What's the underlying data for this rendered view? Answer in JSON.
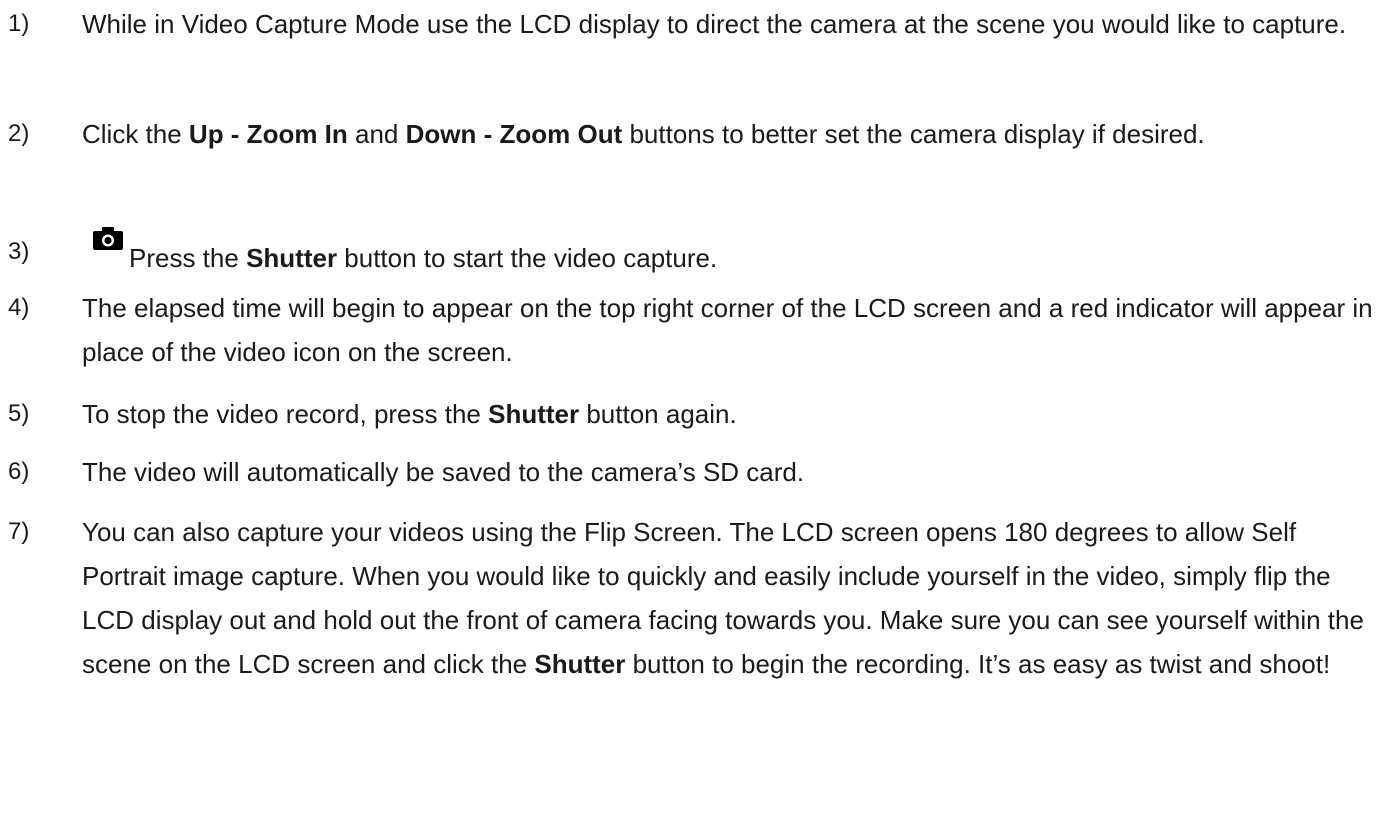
{
  "steps": [
    {
      "number": "1)",
      "parts": [
        {
          "text": "While in Video Capture Mode use the LCD display to direct the camera at the scene you would like to capture."
        }
      ]
    },
    {
      "number": "2)",
      "parts": [
        {
          "text": "Click the "
        },
        {
          "text": "Up - Zoom In",
          "bold": true
        },
        {
          "text": " and "
        },
        {
          "text": "Down - Zoom Out",
          "bold": true
        },
        {
          "text": " buttons to better set the camera display if desired."
        }
      ]
    },
    {
      "number": "3)",
      "icon": "camera-icon",
      "parts": [
        {
          "text": "Press the "
        },
        {
          "text": "Shutter",
          "bold": true
        },
        {
          "text": " button to start the video capture."
        }
      ]
    },
    {
      "number": "4)",
      "parts": [
        {
          "text": "The elapsed time will begin to appear on the top right corner of the LCD screen and a red indicator will appear in place of the video icon on the screen."
        }
      ]
    },
    {
      "number": "5)",
      "parts": [
        {
          "text": "To stop the video record, press the "
        },
        {
          "text": "Shutter",
          "bold": true
        },
        {
          "text": " button again."
        }
      ]
    },
    {
      "number": "6)",
      "parts": [
        {
          "text": "The video will automatically be saved to the camera’s SD card."
        }
      ]
    },
    {
      "number": "7)",
      "parts": [
        {
          "text": "You can also capture your videos using the Flip Screen. The LCD screen opens 180 degrees to allow Self Portrait image capture. When you would like to quickly and easily include yourself in the video, simply flip the LCD display out and hold out the front of camera facing towards you. Make sure you can see yourself within the scene on the LCD screen and click the "
        },
        {
          "text": "Shutter",
          "bold": true
        },
        {
          "text": " button to begin the recording. It’s as easy as twist and shoot!"
        }
      ]
    }
  ]
}
